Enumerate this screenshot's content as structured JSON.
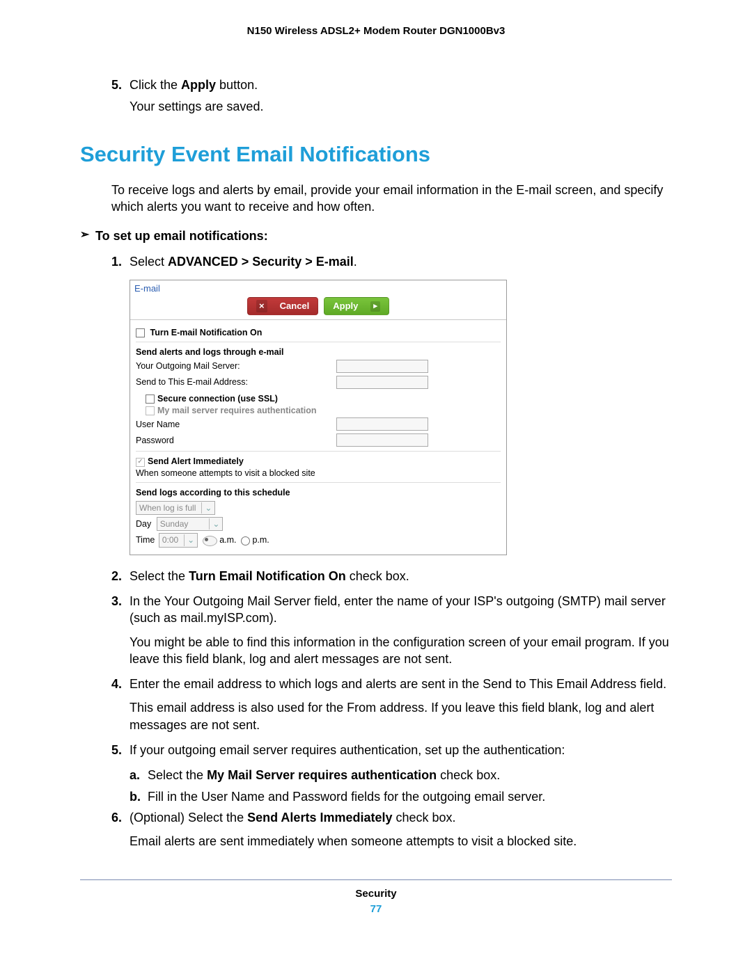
{
  "header": "N150 Wireless ADSL2+ Modem Router DGN1000Bv3",
  "prev": {
    "num": "5.",
    "line1a": "Click the ",
    "line1b": "Apply",
    "line1c": " button.",
    "line2": "Your settings are saved."
  },
  "h1": "Security Event Email Notifications",
  "intro": "To receive logs and alerts by email, provide your email information in the E-mail screen, and specify which alerts you want to receive and how often.",
  "task": "To set up email notifications:",
  "step1": {
    "num": "1.",
    "a": "Select ",
    "b": "ADVANCED > Security > E-mail",
    "c": "."
  },
  "shot": {
    "title": "E-mail",
    "cancel": "Cancel",
    "apply": "Apply",
    "turnOn": "Turn E-mail Notification On",
    "sA": "Send alerts and logs through e-mail",
    "outLbl": "Your Outgoing Mail Server:",
    "toLbl": "Send to This E-mail Address:",
    "ssl": "Secure connection (use SSL)",
    "auth": "My mail server requires authentication",
    "user": "User Name",
    "pass": "Password",
    "sB": "Send Alert Immediately",
    "sBsub": "When someone attempts to visit a blocked site",
    "sC": "Send logs according to this schedule",
    "schedSel": "When log is full",
    "dayLbl": "Day",
    "daySel": "Sunday",
    "timeLbl": "Time",
    "timeSel": "0:00",
    "am": "a.m.",
    "pm": "p.m."
  },
  "step2": {
    "num": "2.",
    "a": "Select the ",
    "b": "Turn Email Notification On",
    "c": " check box."
  },
  "step3": {
    "num": "3.",
    "l1": "In the Your Outgoing Mail Server field, enter the name of your ISP's outgoing (SMTP) mail server (such as mail.myISP.com).",
    "l2": "You might be able to find this information in the configuration screen of your email program. If you leave this field blank, log and alert messages are not sent."
  },
  "step4": {
    "num": "4.",
    "l1": "Enter the email address to which logs and alerts are sent in the Send to This Email Address field.",
    "l2": "This email address is also used for the From address. If you leave this field blank, log and alert messages are not sent."
  },
  "step5": {
    "num": "5.",
    "l1": "If your outgoing email server requires authentication, set up the authentication:",
    "a": {
      "n": "a.",
      "a": "Select the ",
      "b": "My Mail Server requires authentication",
      "c": " check box."
    },
    "b": {
      "n": "b.",
      "t": "Fill in the User Name and Password fields for the outgoing email server."
    }
  },
  "step6": {
    "num": "6.",
    "a": "(Optional) Select the ",
    "b": "Send Alerts Immediately",
    "c": " check box.",
    "l2": "Email alerts are sent immediately when someone attempts to visit a blocked site."
  },
  "footer": {
    "section": "Security",
    "page": "77"
  }
}
